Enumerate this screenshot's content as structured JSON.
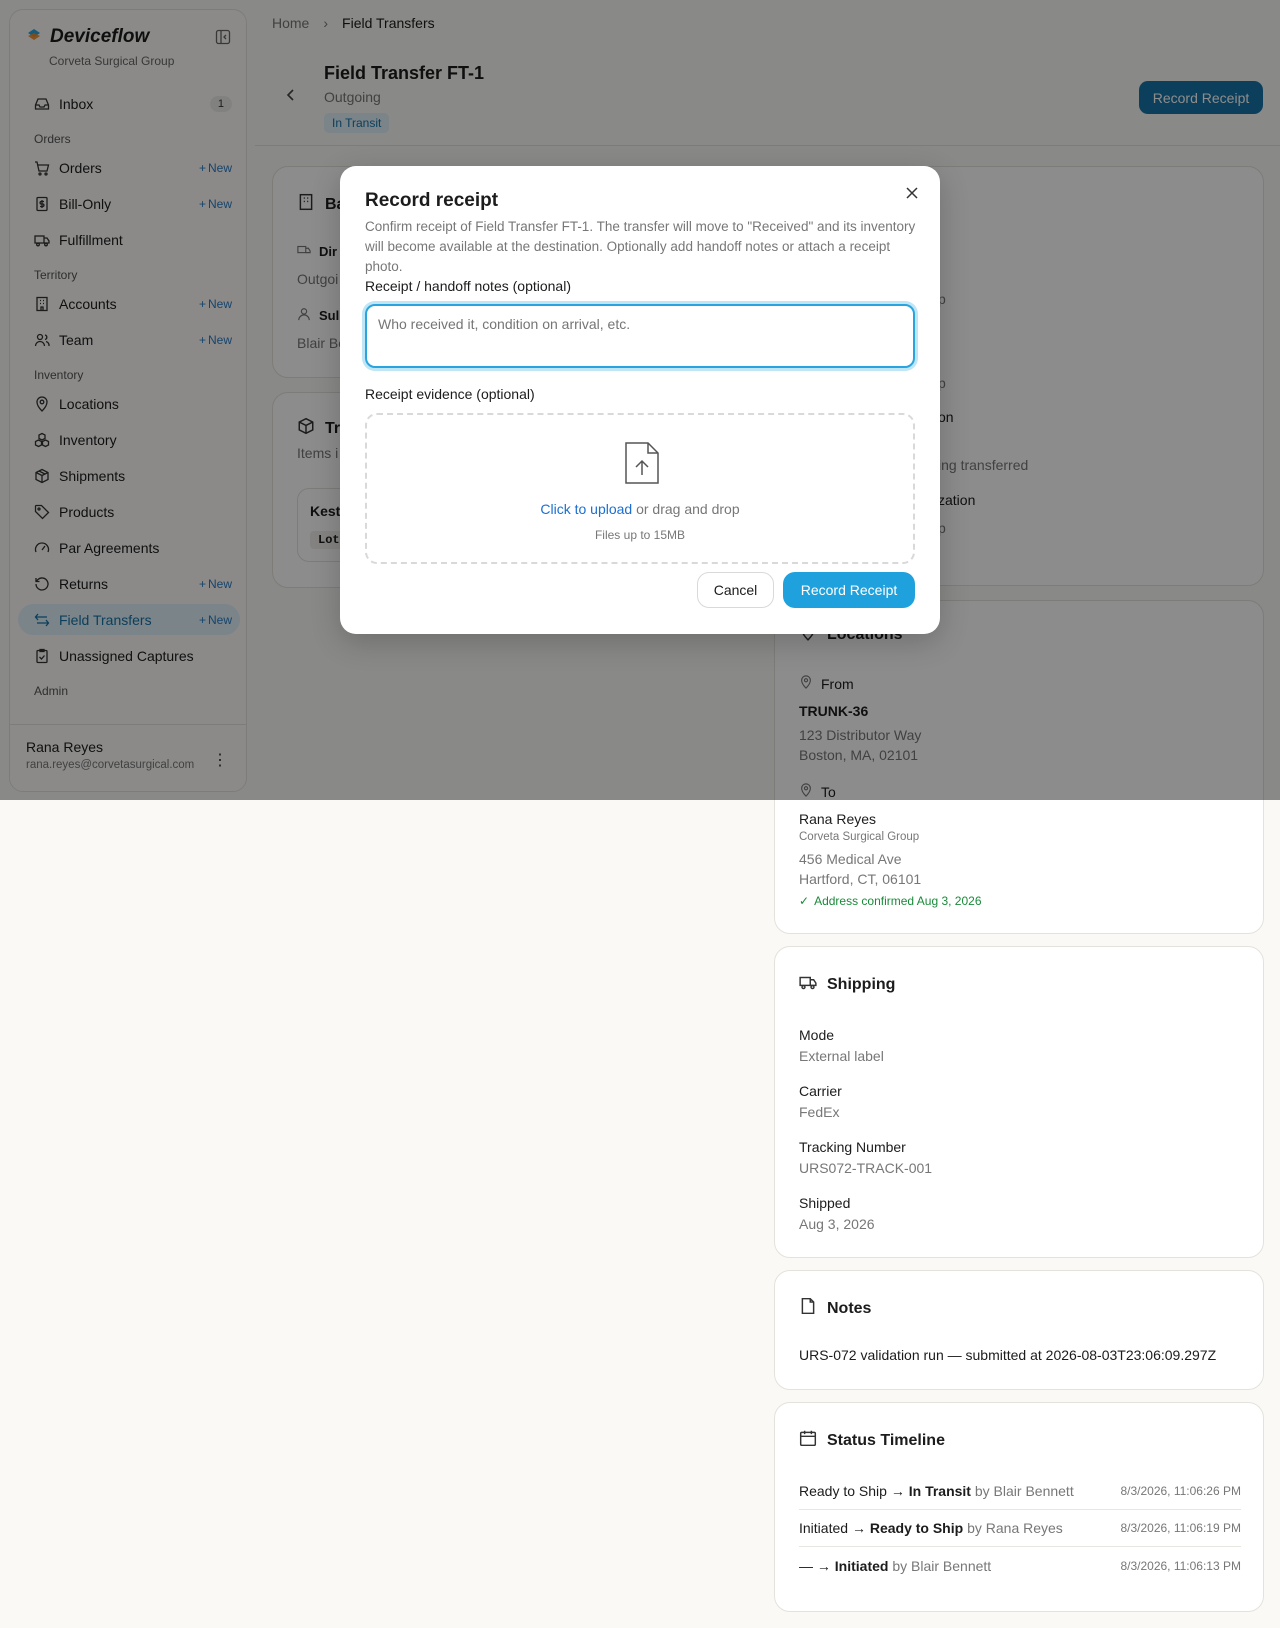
{
  "sidebar": {
    "brand": "Deviceflow",
    "org": "Corveta Surgical Group",
    "new_label": "New",
    "inbox": {
      "label": "Inbox",
      "count": "1"
    },
    "sections": {
      "orders": "Orders",
      "territory": "Territory",
      "inventory": "Inventory",
      "admin": "Admin"
    },
    "items": {
      "orders": "Orders",
      "bill_only": "Bill-Only",
      "fulfillment": "Fulfillment",
      "accounts": "Accounts",
      "team": "Team",
      "locations": "Locations",
      "inventory": "Inventory",
      "shipments": "Shipments",
      "products": "Products",
      "par_agreements": "Par Agreements",
      "returns": "Returns",
      "field_transfers": "Field Transfers",
      "unassigned_captures": "Unassigned Captures"
    },
    "user": {
      "name": "Rana Reyes",
      "email": "rana.reyes@corvetasurgical.com"
    }
  },
  "breadcrumb": {
    "home": "Home",
    "current": "Field Transfers"
  },
  "page": {
    "title": "Field Transfer FT-1",
    "subtitle": "Outgoing",
    "status": "In Transit",
    "record_button": "Record Receipt"
  },
  "background_cards": {
    "basics_title_fragment": "Ba",
    "direction_label_fragment": "Dir",
    "direction_value_fragment": "Outgoi",
    "submitted_label_fragment": "Sul",
    "submitted_value_fragment": "Blair Be",
    "items_title_fragment": "Tr",
    "items_sub_fragment": "Items i",
    "item_name_fragment": "Kest",
    "item_lot_fragment": "Lot",
    "right_frag_1": "p",
    "right_frag_2": "p",
    "right_frag_3": "on",
    "right_frag_4": "ing transferred",
    "right_frag_5": "zation",
    "right_frag_6": "p"
  },
  "modal": {
    "title": "Record receipt",
    "description": "Confirm receipt of Field Transfer FT-1. The transfer will move to \"Received\" and its inventory will become available at the destination. Optionally add handoff notes or attach a receipt photo.",
    "notes_label": "Receipt / handoff notes (optional)",
    "notes_placeholder": "Who received it, condition on arrival, etc.",
    "evidence_label": "Receipt evidence (optional)",
    "upload_link": "Click to upload",
    "upload_text": "or drag and drop",
    "upload_hint": "Files up to 15MB",
    "cancel": "Cancel",
    "confirm": "Record Receipt"
  },
  "locations": {
    "title": "Locations",
    "from_label": "From",
    "from_name": "TRUNK-36",
    "from_address1": "123 Distributor Way",
    "from_address2": "Boston, MA, 02101",
    "to_label": "To",
    "to_name": "Rana Reyes",
    "to_org": "Corveta Surgical Group",
    "to_address1": "456 Medical Ave",
    "to_address2": "Hartford, CT, 06101",
    "confirmed": "Address confirmed Aug 3, 2026"
  },
  "shipping": {
    "title": "Shipping",
    "mode_label": "Mode",
    "mode": "External label",
    "carrier_label": "Carrier",
    "carrier": "FedEx",
    "tracking_label": "Tracking Number",
    "tracking": "URS072-TRACK-001",
    "shipped_label": "Shipped",
    "shipped": "Aug 3, 2026"
  },
  "notes": {
    "title": "Notes",
    "text": "URS-072 validation run — submitted at 2026-08-03T23:06:09.297Z"
  },
  "timeline": {
    "title": "Status Timeline",
    "arrow": "→",
    "by": "by",
    "rows": [
      {
        "from": "Ready to Ship",
        "to": "In Transit",
        "user": "Blair Bennett",
        "time": "8/3/2026, 11:06:26 PM"
      },
      {
        "from": "Initiated",
        "to": "Ready to Ship",
        "user": "Rana Reyes",
        "time": "8/3/2026, 11:06:19 PM"
      },
      {
        "from": "—",
        "to": "Initiated",
        "user": "Blair Bennett",
        "time": "8/3/2026, 11:06:13 PM"
      }
    ]
  },
  "colors": {
    "accent": "#1ea1dc",
    "accent_dark": "#1673a8",
    "success": "#1a8a3a"
  }
}
